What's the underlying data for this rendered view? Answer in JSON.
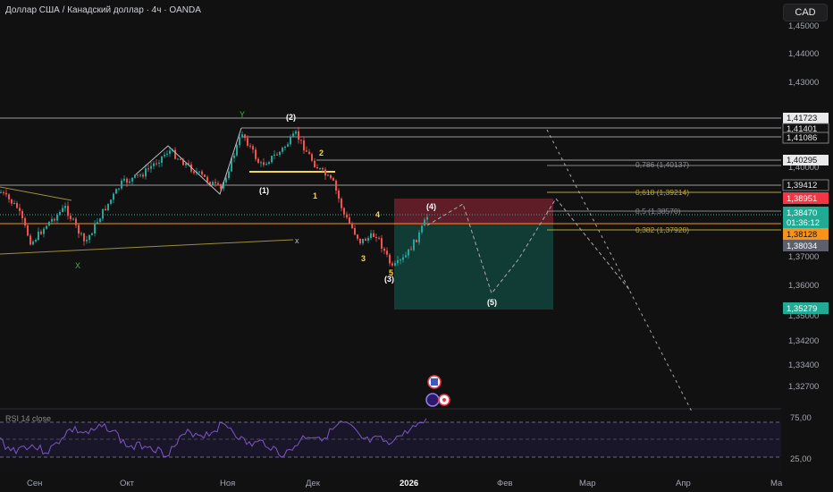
{
  "header": {
    "symbol_title": "Доллар США / Канадский доллар · 4ч · OANDA",
    "currency": "CAD"
  },
  "colors": {
    "background": "#111112",
    "candle_up": "#26a69a",
    "candle_down": "#ef5350",
    "rsi_line": "#7e57c2",
    "fib_line": "#b8a33a",
    "label_white": "#ffffff",
    "label_yellow": "#f7d64a",
    "label_green": "#4caf50",
    "stop_zone": "#7a2230",
    "target_zone": "#12463f",
    "badge_red": "#f23645",
    "badge_teal": "#22ab94",
    "badge_orange": "#f7931a",
    "badge_gray": "#5d606b"
  },
  "price_axis": {
    "ticks": [
      "1,45000",
      "1,44000",
      "1,43000",
      "1,40000",
      "1,37000",
      "1,36000",
      "1,35000",
      "1,34200",
      "1,33400",
      "1,32700"
    ],
    "hline_labels": [
      "1,41723",
      "1,41401",
      "1,41086",
      "1,40295",
      "1,39412"
    ],
    "badges": {
      "stop": "1,38951",
      "current_price": "1,38470",
      "countdown": "01:36:12",
      "orange": "1,38128",
      "gray": "1,38034",
      "target": "1,35279"
    }
  },
  "rsi": {
    "title": "RSI 14 close",
    "ticks": [
      "75,00",
      "25,00"
    ]
  },
  "time_axis": {
    "labels": [
      "Сен",
      "Окт",
      "Ноя",
      "Дек",
      "2026",
      "Фев",
      "Мар",
      "Апр",
      "Ма"
    ]
  },
  "fib_levels": [
    {
      "label": "0,786 (1,40137)"
    },
    {
      "label": "0,618 (1,39214)"
    },
    {
      "label": "0,5 (1,38570)"
    },
    {
      "label": "0,382 (1,37928)"
    }
  ],
  "wave_labels": {
    "w2": "(2)",
    "w1": "(1)",
    "w3": "(3)",
    "w4": "(4)",
    "w5": "(5)",
    "s1": "1",
    "s2": "2",
    "s3": "3",
    "s4": "4",
    "s5": "5",
    "Y": "Y",
    "X": "X",
    "x": "x"
  }
}
